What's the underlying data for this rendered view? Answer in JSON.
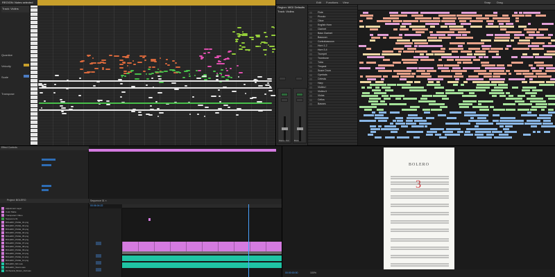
{
  "piano_roll": {
    "region_title": "REGION: Notes selected",
    "inspector": {
      "title": "Track: Violins",
      "fields": [
        "Quantize",
        "Velocity",
        "Scale",
        "Transpose"
      ]
    },
    "colors": {
      "ruler": "#c9a02b",
      "notes_orange": "#d8683c",
      "notes_green": "#48c04a",
      "notes_pink": "#e04fb0",
      "notes_white": "#e8e8e8",
      "notes_lime": "#95cf3a"
    }
  },
  "logic": {
    "toolbar": [
      "Edit",
      "Functions",
      "View",
      "Snap",
      "Drag"
    ],
    "region_label": "Region: MIDI Defaults",
    "track_label": "Track: Violins",
    "tracks": [
      "Flute",
      "Piccolo",
      "Oboe",
      "English Horn",
      "Clarinet",
      "Bass Clarinet",
      "Bassoon",
      "Contrabassoon",
      "Horn 1-2",
      "Horn 3-4",
      "Trumpet",
      "Trombone",
      "Tuba",
      "Timpani",
      "Snare Drum",
      "Cymbals",
      "Celesta",
      "Harp",
      "Violins I",
      "Violins II",
      "Violas",
      "Cellos",
      "Basses"
    ],
    "strip_labels": [
      "Stereo Out",
      "Bnce"
    ],
    "colors": {
      "region_salmon": "#e8a28a",
      "region_pink": "#e2a0d8",
      "region_green": "#a5e29a",
      "region_blue": "#8ab7e6",
      "region_cream": "#f0d9a5"
    }
  },
  "premiere": {
    "effect_controls_tab": "Effect Controls",
    "sequence_tab": "Sequence 01 ×",
    "project_tab": "Project: BOLERO",
    "project_items": [
      "Adjustment Layer",
      "Color Matte",
      "Transparent Video",
      "Sequence 01",
      "BOLERO_PAGE_01.png",
      "BOLERO_PAGE_02.png",
      "BOLERO_PAGE_03.png",
      "BOLERO_PAGE_04.png",
      "BOLERO_PAGE_05.png",
      "BOLERO_PAGE_06.png",
      "BOLERO_PAGE_07.png",
      "BOLERO_PAGE_08.png",
      "BOLERO_PAGE_09.png",
      "BOLERO_PAGE_10.png",
      "BOLERO_PAGE_11.png",
      "BOLERO_PAGE_12.png",
      "BOLERO_Mix.wav",
      "BOLERO_Stems.wav",
      "Orchestral_Bolero_Full.wav"
    ],
    "sequence_name": "Sequence 01",
    "timecode": "00:06:04:22",
    "colors": {
      "video_clip": "#d47be0",
      "audio_clip": "#1fc4a4",
      "playhead": "#4aa3ff"
    }
  },
  "score": {
    "title": "BOLERO",
    "page_marking": "3",
    "zoom": "100%",
    "status_text": "00:00:00:00"
  }
}
